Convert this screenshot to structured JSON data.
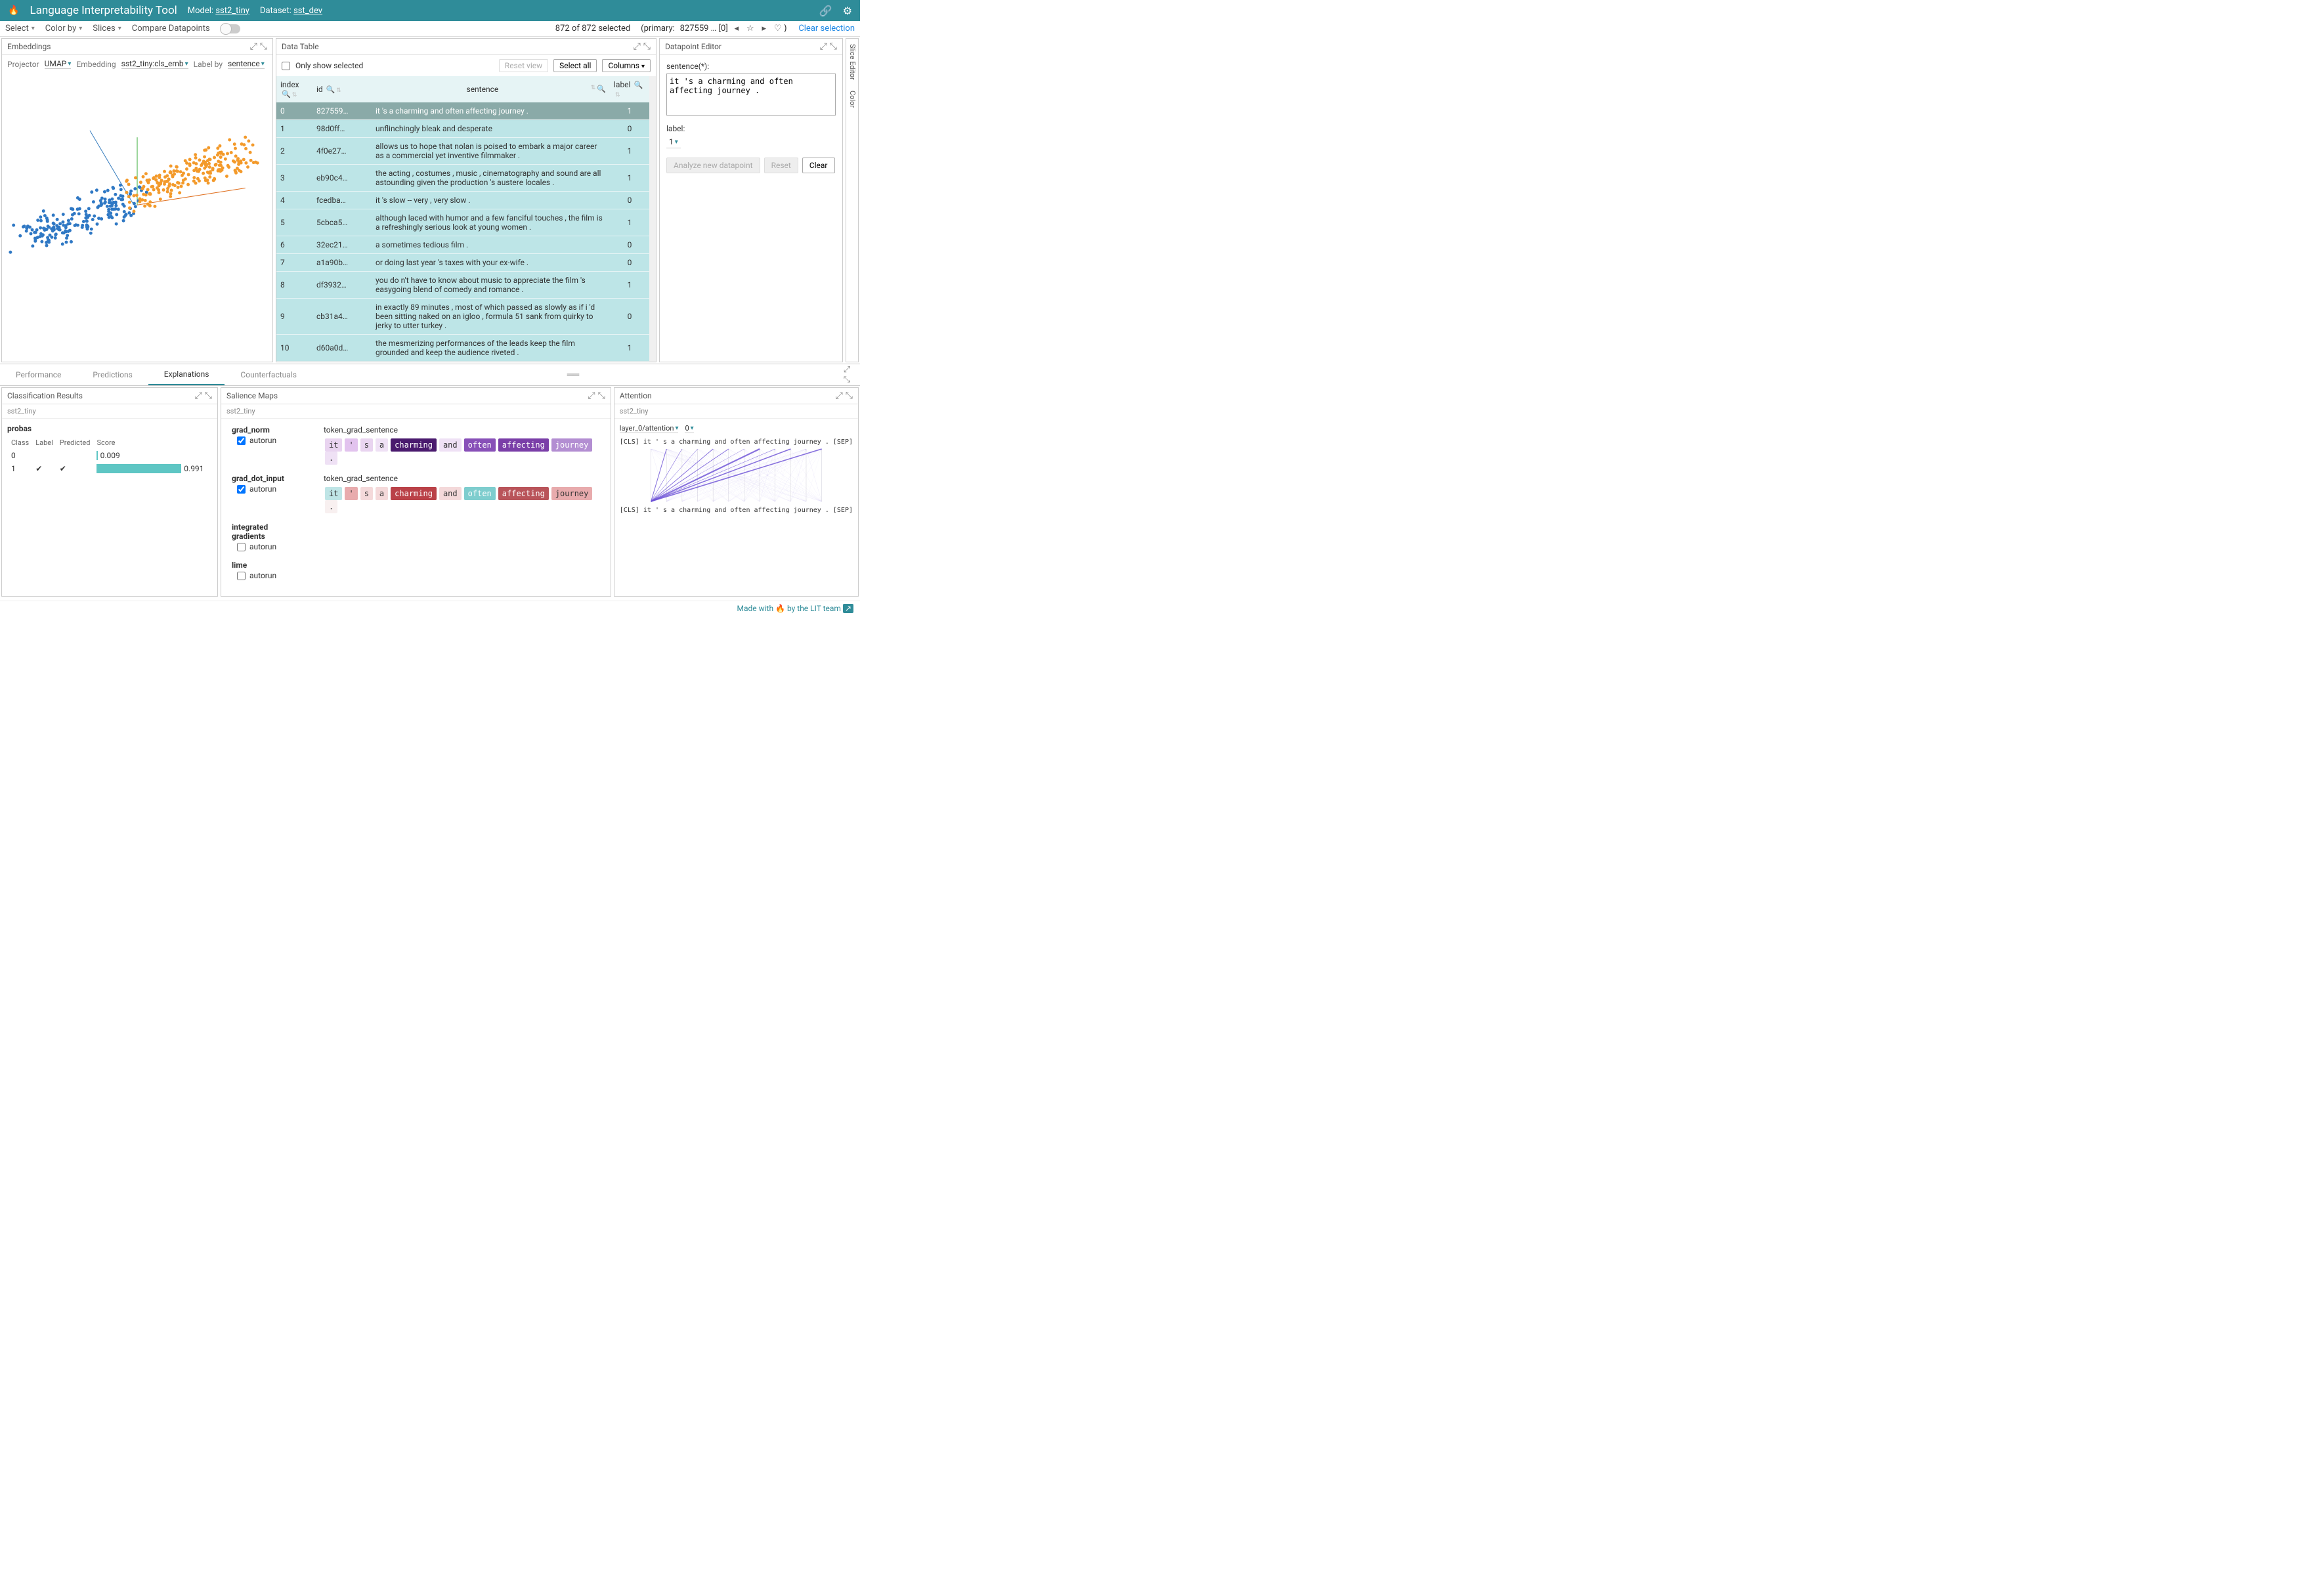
{
  "header": {
    "title": "Language Interpretability Tool",
    "model_label": "Model:",
    "model_value": "sst2_tiny",
    "dataset_label": "Dataset:",
    "dataset_value": "sst_dev"
  },
  "toolbar": {
    "select": "Select",
    "colorby": "Color by",
    "slices": "Slices",
    "compare": "Compare Datapoints",
    "status": "872 of 872 selected",
    "primary_label": "(primary:",
    "primary_id": "827559 … [0]",
    "clear": "Clear selection"
  },
  "embeddings": {
    "title": "Embeddings",
    "projector_label": "Projector",
    "projector_value": "UMAP",
    "embedding_label": "Embedding",
    "embedding_value": "sst2_tiny:cls_emb",
    "labelby_label": "Label by",
    "labelby_value": "sentence"
  },
  "datatable": {
    "title": "Data Table",
    "only_show_selected": "Only show selected",
    "reset_view": "Reset view",
    "select_all": "Select all",
    "columns": "Columns",
    "columns_header": [
      "index",
      "id",
      "sentence",
      "label"
    ],
    "rows": [
      {
        "index": "0",
        "id": "827559…",
        "sentence": "it 's a charming and often affecting journey .",
        "label": "1",
        "primary": true
      },
      {
        "index": "1",
        "id": "98d0ff…",
        "sentence": "unflinchingly bleak and desperate",
        "label": "0"
      },
      {
        "index": "2",
        "id": "4f0e27…",
        "sentence": "allows us to hope that nolan is poised to embark a major career as a commercial yet inventive filmmaker .",
        "label": "1"
      },
      {
        "index": "3",
        "id": "eb90c4…",
        "sentence": "the acting , costumes , music , cinematography and sound are all astounding given the production 's austere locales .",
        "label": "1"
      },
      {
        "index": "4",
        "id": "fcedba…",
        "sentence": "it 's slow -- very , very slow .",
        "label": "0"
      },
      {
        "index": "5",
        "id": "5cbca5…",
        "sentence": "although laced with humor and a few fanciful touches , the film is a refreshingly serious look at young women .",
        "label": "1"
      },
      {
        "index": "6",
        "id": "32ec21…",
        "sentence": "a sometimes tedious film .",
        "label": "0"
      },
      {
        "index": "7",
        "id": "a1a90b…",
        "sentence": "or doing last year 's taxes with your ex-wife .",
        "label": "0"
      },
      {
        "index": "8",
        "id": "df3932…",
        "sentence": "you do n't have to know about music to appreciate the film 's easygoing blend of comedy and romance .",
        "label": "1"
      },
      {
        "index": "9",
        "id": "cb31a4…",
        "sentence": "in exactly 89 minutes , most of which passed as slowly as if i 'd been sitting naked on an igloo , formula 51 sank from quirky to jerky to utter turkey .",
        "label": "0"
      },
      {
        "index": "10",
        "id": "d60a0d…",
        "sentence": "the mesmerizing performances of the leads keep the film grounded and keep the audience riveted .",
        "label": "1"
      }
    ]
  },
  "editor": {
    "title": "Datapoint Editor",
    "sentence_label": "sentence(*):",
    "sentence_value": "it 's a charming and often affecting journey .",
    "label_label": "label:",
    "label_value": "1",
    "analyze": "Analyze new datapoint",
    "reset": "Reset",
    "clear": "Clear"
  },
  "siderails": {
    "slice_editor": "Slice Editor",
    "color": "Color"
  },
  "tabs": {
    "performance": "Performance",
    "predictions": "Predictions",
    "explanations": "Explanations",
    "counterfactuals": "Counterfactuals",
    "active": "Explanations"
  },
  "classres": {
    "title": "Classification Results",
    "subtab": "sst2_tiny",
    "probas": "probas",
    "headers": [
      "Class",
      "Label",
      "Predicted",
      "Score"
    ],
    "rows": [
      {
        "class": "0",
        "label": "",
        "predicted": "",
        "score": 0.009
      },
      {
        "class": "1",
        "label": "✔",
        "predicted": "✔",
        "score": 0.991
      }
    ]
  },
  "salience": {
    "title": "Salience Maps",
    "subtab": "sst2_tiny",
    "token_label": "token_grad_sentence",
    "autorun": "autorun",
    "sections": [
      {
        "name": "grad_norm",
        "autorun_checked": true,
        "tokens": [
          {
            "t": "it",
            "c": "#e9d4f0"
          },
          {
            "t": "'",
            "c": "#e2c3ee"
          },
          {
            "t": "s",
            "c": "#e9d4f0"
          },
          {
            "t": "a",
            "c": "#efe1f5"
          },
          {
            "t": "charming",
            "c": "#4a1a6e",
            "fg": "#fff"
          },
          {
            "t": "and",
            "c": "#efe1f5"
          },
          {
            "t": "often",
            "c": "#8850b8",
            "fg": "#fff"
          },
          {
            "t": "affecting",
            "c": "#7a3ea8",
            "fg": "#fff"
          },
          {
            "t": "journey",
            "c": "#b38ed2",
            "fg": "#fff"
          },
          {
            "t": ".",
            "c": "#efe1f5"
          }
        ]
      },
      {
        "name": "grad_dot_input",
        "autorun_checked": true,
        "tokens": [
          {
            "t": "it",
            "c": "#bfe5e6"
          },
          {
            "t": "'",
            "c": "#e8abad"
          },
          {
            "t": "s",
            "c": "#f4d9da"
          },
          {
            "t": "a",
            "c": "#f4d9da"
          },
          {
            "t": "charming",
            "c": "#ba4148",
            "fg": "#fff"
          },
          {
            "t": "and",
            "c": "#f4d9da"
          },
          {
            "t": "often",
            "c": "#7ecdce",
            "fg": "#fff"
          },
          {
            "t": "affecting",
            "c": "#b9545a",
            "fg": "#fff"
          },
          {
            "t": "journey",
            "c": "#e8abad"
          },
          {
            "t": ".",
            "c": "#f8f0f0"
          }
        ]
      },
      {
        "name": "integrated gradients",
        "autorun_checked": false
      },
      {
        "name": "lime",
        "autorun_checked": false
      }
    ]
  },
  "attention": {
    "title": "Attention",
    "subtab": "sst2_tiny",
    "layer_value": "layer_0/attention",
    "head_value": "0",
    "tokens_top": "[CLS] it ' s a charming and often affecting journey . [SEP]",
    "tokens_bottom": "[CLS] it ' s a charming and often affecting journey . [SEP]"
  },
  "footer": {
    "text": "Made with 🔥 by the LIT team"
  },
  "chart_data": {
    "type": "bar",
    "title": "probas",
    "categories": [
      "0",
      "1"
    ],
    "values": [
      0.009,
      0.991
    ],
    "xlabel": "Class",
    "ylabel": "Score",
    "ylim": [
      0,
      1
    ]
  }
}
